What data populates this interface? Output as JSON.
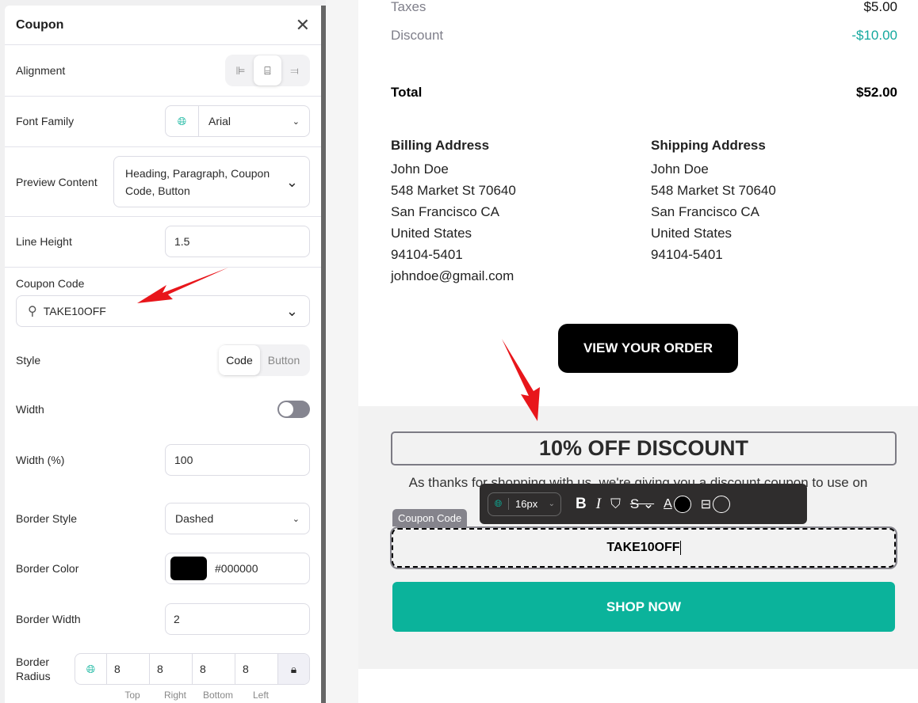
{
  "panel": {
    "title": "Coupon",
    "alignment": {
      "label": "Alignment",
      "options": [
        "align-left",
        "align-center",
        "align-right"
      ],
      "selected": "align-center"
    },
    "font_family": {
      "label": "Font Family",
      "value": "Arial"
    },
    "preview_content": {
      "label": "Preview Content",
      "value": "Heading, Paragraph, Coupon Code, Button"
    },
    "line_height": {
      "label": "Line Height",
      "value": "1.5"
    },
    "coupon_code": {
      "label": "Coupon Code",
      "value": "TAKE10OFF"
    },
    "style": {
      "label": "Style",
      "options": [
        "Code",
        "Button"
      ],
      "selected": "Code"
    },
    "width": {
      "label": "Width",
      "toggle": false
    },
    "width_pct": {
      "label": "Width (%)",
      "value": "100"
    },
    "border_style": {
      "label": "Border Style",
      "value": "Dashed"
    },
    "border_color": {
      "label": "Border Color",
      "value": "#000000"
    },
    "border_width": {
      "label": "Border Width",
      "value": "2"
    },
    "border_radius": {
      "label1": "Border",
      "label2": "Radius",
      "values": [
        "8",
        "8",
        "8",
        "8"
      ],
      "sides": [
        "Top",
        "Right",
        "Bottom",
        "Left"
      ]
    }
  },
  "email": {
    "taxes": {
      "label": "Taxes",
      "value": "$5.00"
    },
    "discount": {
      "label": "Discount",
      "value": "-$10.00"
    },
    "total": {
      "label": "Total",
      "value": "$52.00"
    },
    "billing": {
      "title": "Billing Address",
      "lines": [
        "John Doe",
        "548 Market St 70640",
        "San Francisco CA",
        "United States",
        "94104-5401",
        "johndoe@gmail.com"
      ]
    },
    "shipping": {
      "title": "Shipping Address",
      "lines": [
        "John Doe",
        "548 Market St 70640",
        "San Francisco CA",
        "United States",
        "94104-5401"
      ]
    },
    "view_order": "VIEW YOUR ORDER",
    "coupon_heading": "10% OFF DISCOUNT",
    "coupon_paragraph": "As thanks for shopping with us, we're giving you a discount coupon to use on",
    "coupon_tag": "Coupon Code",
    "coupon_code": "TAKE10OFF",
    "shop_now": "SHOP NOW",
    "toolbar": {
      "font_size": "16px"
    }
  },
  "colors": {
    "accent": "#0bb39b",
    "discount": "#13a89e",
    "toolbar_bg": "#2f2d2d",
    "arrow": "#e8161b"
  }
}
